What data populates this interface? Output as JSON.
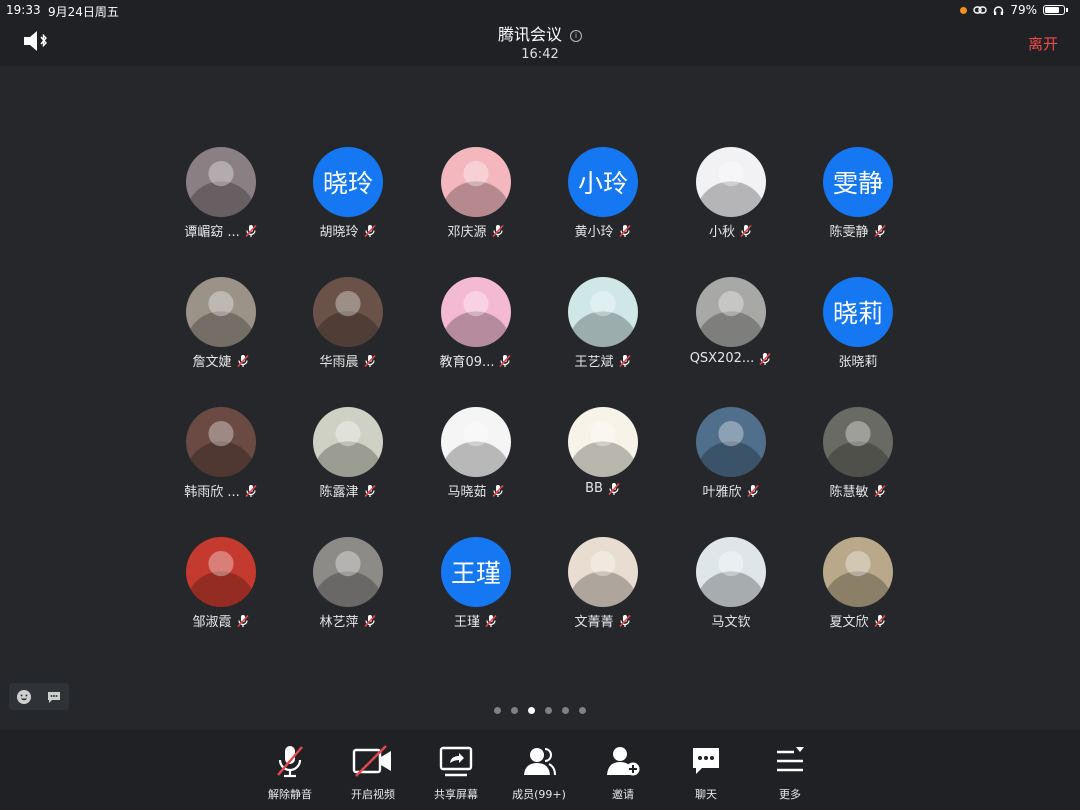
{
  "status_bar": {
    "time": "19:33",
    "date": "9月24日周五",
    "battery": "79%",
    "battery_level": 0.79
  },
  "header": {
    "title": "腾讯会议",
    "timer": "16:42",
    "leave_label": "离开"
  },
  "members": [
    {
      "name": "谭嵋窈 ...",
      "avatar_text": null,
      "avatar_color": "#8a7f82",
      "muted": true
    },
    {
      "name": "胡晓玲",
      "avatar_text": "晓玲",
      "avatar_color": "#1677f2",
      "muted": true
    },
    {
      "name": "邓庆源",
      "avatar_text": null,
      "avatar_color": "#f3b7bd",
      "muted": true
    },
    {
      "name": "黄小玲",
      "avatar_text": "小玲",
      "avatar_color": "#1677f2",
      "muted": true
    },
    {
      "name": "小秋",
      "avatar_text": null,
      "avatar_color": "#f2f2f4",
      "muted": true
    },
    {
      "name": "陈雯静",
      "avatar_text": "雯静",
      "avatar_color": "#1677f2",
      "muted": true
    },
    {
      "name": "詹文婕",
      "avatar_text": null,
      "avatar_color": "#9b9288",
      "muted": true
    },
    {
      "name": "华雨晨",
      "avatar_text": null,
      "avatar_color": "#6a5248",
      "muted": true
    },
    {
      "name": "教育09...",
      "avatar_text": null,
      "avatar_color": "#f4b9d3",
      "muted": true
    },
    {
      "name": "王艺斌",
      "avatar_text": null,
      "avatar_color": "#cfe7e6",
      "muted": true
    },
    {
      "name": "QSX202...",
      "avatar_text": null,
      "avatar_color": "#a8a8a6",
      "muted": true
    },
    {
      "name": "张晓莉",
      "avatar_text": "晓莉",
      "avatar_color": "#1677f2",
      "muted": false
    },
    {
      "name": "韩雨欣 ...",
      "avatar_text": null,
      "avatar_color": "#6a4a42",
      "muted": true
    },
    {
      "name": "陈露津",
      "avatar_text": null,
      "avatar_color": "#cfd1c4",
      "muted": true
    },
    {
      "name": "马晓茹",
      "avatar_text": null,
      "avatar_color": "#f5f5f5",
      "muted": true
    },
    {
      "name": "BB",
      "avatar_text": null,
      "avatar_color": "#f7f3e8",
      "muted": true
    },
    {
      "name": "叶雅欣",
      "avatar_text": null,
      "avatar_color": "#4f6f8c",
      "muted": true
    },
    {
      "name": "陈慧敏",
      "avatar_text": null,
      "avatar_color": "#6a6a64",
      "muted": true
    },
    {
      "name": "邹淑霞",
      "avatar_text": null,
      "avatar_color": "#c53a2e",
      "muted": true
    },
    {
      "name": "林艺萍",
      "avatar_text": null,
      "avatar_color": "#8d8b88",
      "muted": true
    },
    {
      "name": "王瑾",
      "avatar_text": "王瑾",
      "avatar_color": "#1677f2",
      "muted": true
    },
    {
      "name": "文菁菁",
      "avatar_text": null,
      "avatar_color": "#e8ddd0",
      "muted": true
    },
    {
      "name": "马文钦",
      "avatar_text": null,
      "avatar_color": "#dfe6ea",
      "muted": false
    },
    {
      "name": "夏文欣",
      "avatar_text": null,
      "avatar_color": "#b9a98a",
      "muted": true
    }
  ],
  "pagination": {
    "pages": 6,
    "current": 3
  },
  "toolbar": {
    "unmute": "解除静音",
    "video": "开启视频",
    "share": "共享屏幕",
    "members": "成员(99+)",
    "invite": "邀请",
    "chat": "聊天",
    "more": "更多"
  },
  "icons": {
    "speaker": "speaker-bluetooth-icon",
    "info": "info-icon",
    "emoji": "emoji-icon",
    "comment": "comment-icon"
  },
  "colors": {
    "accent": "#1677f2",
    "leave": "#ef4b4b",
    "muted": "#e5484d"
  }
}
